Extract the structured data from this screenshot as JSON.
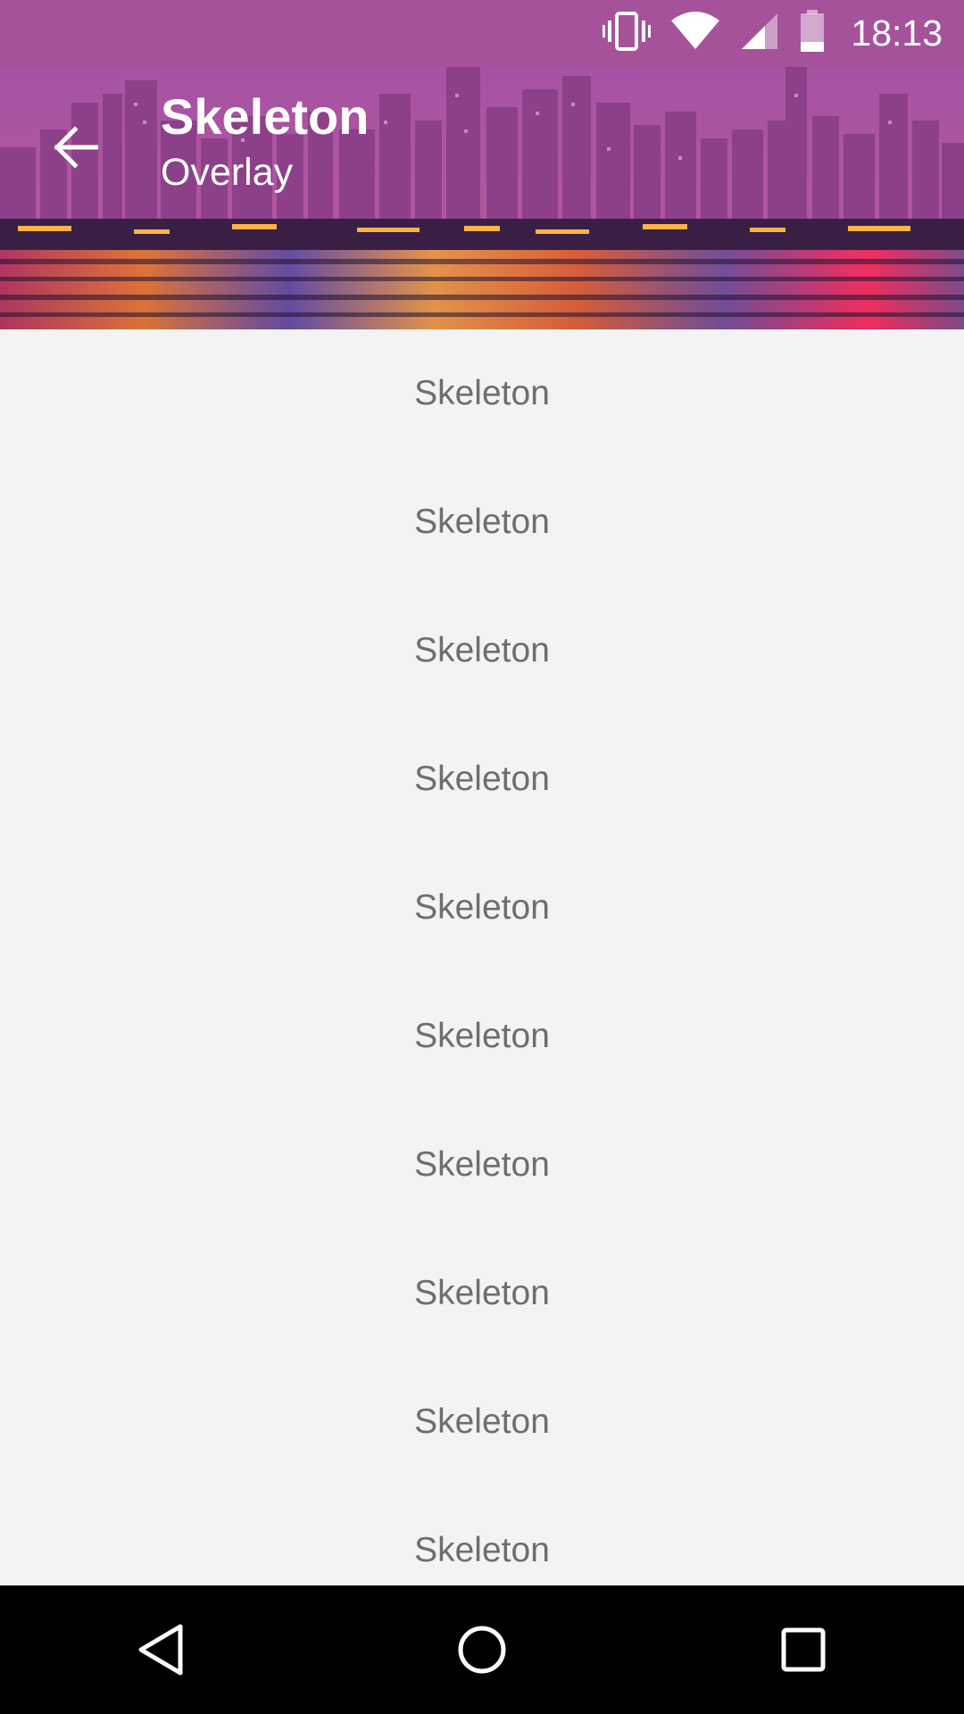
{
  "status_bar": {
    "time": "18:13",
    "icons": [
      "vibrate-icon",
      "wifi-icon",
      "cell-signal-icon",
      "battery-icon"
    ]
  },
  "toolbar": {
    "title": "Skeleton",
    "subtitle": "Overlay",
    "back_icon": "arrow-back-icon",
    "accent_color": "#a5529a"
  },
  "list": {
    "items": [
      {
        "label": "Skeleton"
      },
      {
        "label": "Skeleton"
      },
      {
        "label": "Skeleton"
      },
      {
        "label": "Skeleton"
      },
      {
        "label": "Skeleton"
      },
      {
        "label": "Skeleton"
      },
      {
        "label": "Skeleton"
      },
      {
        "label": "Skeleton"
      },
      {
        "label": "Skeleton"
      },
      {
        "label": "Skeleton"
      }
    ]
  },
  "nav_bar": {
    "buttons": [
      "back-triangle-icon",
      "home-circle-icon",
      "recents-square-icon"
    ]
  }
}
